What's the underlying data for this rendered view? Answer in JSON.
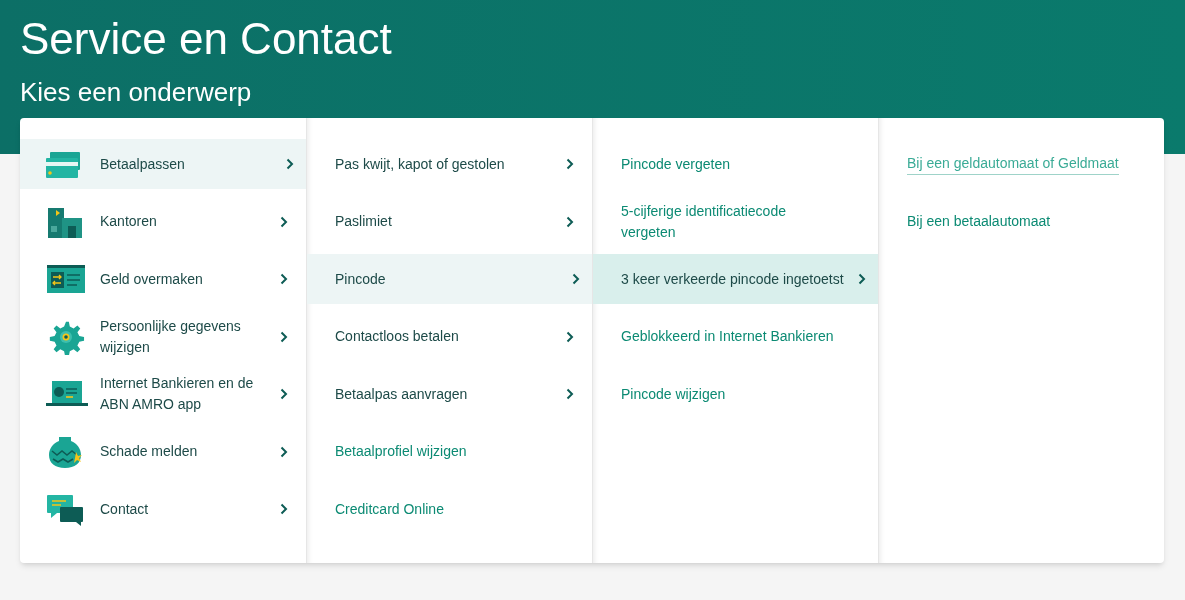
{
  "header": {
    "title": "Service en Contact",
    "subtitle": "Kies een onderwerp"
  },
  "columns": [
    {
      "items": [
        {
          "label": "Betaalpassen",
          "submenu": true,
          "selected": true
        },
        {
          "label": "Kantoren",
          "submenu": true,
          "selected": false
        },
        {
          "label": "Geld overmaken",
          "submenu": true,
          "selected": false
        },
        {
          "label": "Persoonlijke gegevens wijzigen",
          "submenu": true,
          "selected": false
        },
        {
          "label": "Internet Bankieren en de ABN AMRO app",
          "submenu": true,
          "selected": false
        },
        {
          "label": "Schade melden",
          "submenu": true,
          "selected": false
        },
        {
          "label": "Contact",
          "submenu": true,
          "selected": false
        }
      ]
    },
    {
      "items": [
        {
          "label": "Pas kwijt, kapot of gestolen",
          "submenu": true,
          "selected": false
        },
        {
          "label": "Paslimiet",
          "submenu": true,
          "selected": false
        },
        {
          "label": "Pincode",
          "submenu": true,
          "selected": true
        },
        {
          "label": "Contactloos betalen",
          "submenu": true,
          "selected": false
        },
        {
          "label": "Betaalpas aanvragen",
          "submenu": true,
          "selected": false
        },
        {
          "label": "Betaalprofiel wijzigen",
          "submenu": false,
          "selected": false
        },
        {
          "label": "Creditcard Online",
          "submenu": false,
          "selected": false
        }
      ]
    },
    {
      "items": [
        {
          "label": "Pincode vergeten",
          "submenu": false,
          "selected": false
        },
        {
          "label": "5-cijferige identificatiecode vergeten",
          "submenu": false,
          "selected": false
        },
        {
          "label": "3 keer verkeerde pincode ingetoetst",
          "submenu": true,
          "selected": true
        },
        {
          "label": "Geblokkeerd in Internet Bankieren",
          "submenu": false,
          "selected": false
        },
        {
          "label": "Pincode wijzigen",
          "submenu": false,
          "selected": false
        }
      ]
    },
    {
      "items": [
        {
          "label": "Bij een geldautomaat of Geldmaat",
          "submenu": false,
          "selected": false,
          "hovered": true
        },
        {
          "label": "Bij een betaalautomaat",
          "submenu": false,
          "selected": false,
          "hovered": false
        }
      ]
    }
  ]
}
